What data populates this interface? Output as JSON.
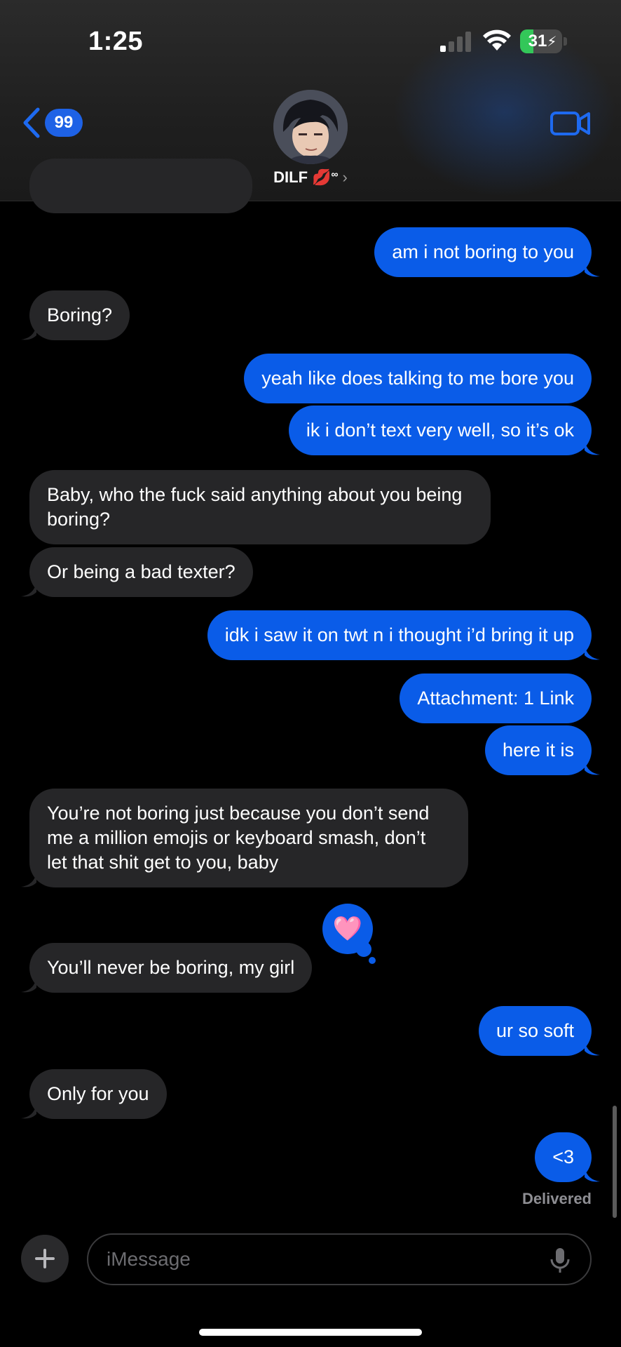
{
  "status_bar": {
    "time": "1:25",
    "battery": "31"
  },
  "header": {
    "back_badge": "99",
    "contact_name": "DILF 💋",
    "contact_suffix": "∞",
    "chevron": "›"
  },
  "messages": [
    {
      "from": "me",
      "text": "am i not boring to you"
    },
    {
      "from": "them",
      "text": "Boring?"
    },
    {
      "from": "me",
      "text": "yeah like does talking to me bore you"
    },
    {
      "from": "me",
      "text": "ik i don’t text very well, so it’s ok"
    },
    {
      "from": "them",
      "text": "Baby, who the fuck said anything about you being boring?"
    },
    {
      "from": "them",
      "text": "Or being a bad texter?"
    },
    {
      "from": "me",
      "text": "idk i saw it on twt n i thought i’d bring it up"
    },
    {
      "from": "me",
      "text": "Attachment: 1 Link"
    },
    {
      "from": "me",
      "text": "here it is"
    },
    {
      "from": "them",
      "text": "You’re not boring just because you don’t send me a million emojis or keyboard smash, don’t let that shit get to you, baby"
    },
    {
      "from": "them",
      "text": "You’ll never be boring, my girl"
    },
    {
      "from": "me",
      "text": "ur so soft"
    },
    {
      "from": "them",
      "text": "Only for you"
    },
    {
      "from": "me",
      "text": "<3"
    }
  ],
  "reaction": {
    "icon": "pink-heart-icon",
    "emoji": "🩷"
  },
  "delivered_label": "Delivered",
  "composer": {
    "placeholder": "iMessage"
  },
  "colors": {
    "outgoing": "#0a5ce8",
    "incoming": "#262628",
    "badge": "#1e62e6",
    "battery": "#33c759"
  }
}
